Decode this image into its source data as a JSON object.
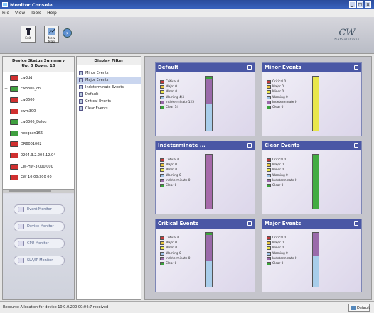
{
  "window": {
    "title": "Monitor Console"
  },
  "menu": [
    "File",
    "View",
    "Tools",
    "Help"
  ],
  "toolbar": {
    "btn1_label": "Exit",
    "btn2_label": "New Map"
  },
  "logo": {
    "mark": "CW",
    "subtext": "NetSolutions"
  },
  "left_pane": {
    "header": "Device Status Summary",
    "subheader": "Up: 5  Down: 15",
    "devices": [
      {
        "name": "cw3dd",
        "color": "#d03030",
        "expand": ""
      },
      {
        "name": "cw3306_cn",
        "color": "#40a040",
        "expand": "+"
      },
      {
        "name": "cw3600",
        "color": "#d03030",
        "expand": ""
      },
      {
        "name": "cwm300",
        "color": "#d03030",
        "expand": ""
      },
      {
        "name": "cw3306_Dalog",
        "color": "#40a040",
        "expand": ""
      },
      {
        "name": "hengcan166",
        "color": "#40a040",
        "expand": ""
      },
      {
        "name": "DR6001002",
        "color": "#d03030",
        "expand": ""
      },
      {
        "name": "0204.3.2.204.12.04",
        "color": "#d03030",
        "expand": ""
      },
      {
        "name": "CW-HW-3.000.000",
        "color": "#d03030",
        "expand": ""
      },
      {
        "name": "CW-10:00:300 00",
        "color": "#d03030",
        "expand": ""
      }
    ],
    "monitors": [
      "Event Monitor",
      "Device Monitor",
      "CPU Monitor",
      "SLA/IP Monitor"
    ]
  },
  "filter_pane": {
    "header": "Display Filter",
    "items": [
      "Minor Events",
      "Major Events",
      "Indeterminate Events",
      "Default",
      "Critical Events",
      "Clear Events"
    ],
    "selected_index": 1
  },
  "legend_labels": [
    "Critical 0",
    "Major 0",
    "Minor 0",
    "Warning 0",
    "Indeterminate 0",
    "Clear 0"
  ],
  "legend_colors": [
    "#c23b3b",
    "#e4c23d",
    "#e8e24a",
    "#9ec3e6",
    "#9a6aaa",
    "#3aa33a"
  ],
  "panels": [
    {
      "title": "Default",
      "segments": [
        {
          "color": "#3aa33a",
          "frac": 0.05
        },
        {
          "color": "#9a6aaa",
          "frac": 0.45
        },
        {
          "color": "#a8cdea",
          "frac": 0.5
        }
      ],
      "legend": [
        "Critical 0",
        "Major 0",
        "Minor 0",
        "Warning 4/4",
        "Indeterminate 125",
        "Clear 14"
      ]
    },
    {
      "title": "Minor Events",
      "segments": [
        {
          "color": "#e8e64c",
          "frac": 1.0
        }
      ],
      "legend": [
        "Critical 0",
        "Major 0",
        "Minor 0",
        "Warning 0",
        "Indeterminate 0",
        "Clear 0"
      ]
    },
    {
      "title": "Indeterminate ...",
      "segments": [
        {
          "color": "#a66aaa",
          "frac": 1.0
        }
      ],
      "legend": [
        "Critical 0",
        "Major 0",
        "Minor 0",
        "Warning 0",
        "Indeterminate 0",
        "Clear 0"
      ]
    },
    {
      "title": "Clear Events",
      "segments": [
        {
          "color": "#42ac42",
          "frac": 1.0
        }
      ],
      "legend": [
        "Critical 0",
        "Major 0",
        "Minor 0",
        "Warning 0",
        "Indeterminate 0",
        "Clear 0"
      ]
    },
    {
      "title": "Critical Events",
      "segments": [
        {
          "color": "#3aa33a",
          "frac": 0.04
        },
        {
          "color": "#9a6aaa",
          "frac": 0.48
        },
        {
          "color": "#a8cdea",
          "frac": 0.48
        }
      ],
      "legend": [
        "Critical 0",
        "Major 0",
        "Minor 0",
        "Warning 0",
        "Indeterminate 0",
        "Clear 0"
      ]
    },
    {
      "title": "Major Events",
      "segments": [
        {
          "color": "#9a6aaa",
          "frac": 0.42
        },
        {
          "color": "#a8cdea",
          "frac": 0.58
        }
      ],
      "legend": [
        "Critical 0",
        "Major 0",
        "Minor 0",
        "Warning 0",
        "Indeterminate 0",
        "Clear 0"
      ]
    }
  ],
  "status": {
    "message": "Resource Allocation for device 10.0.0.200 00:04:7 received",
    "default_button": "Default"
  }
}
